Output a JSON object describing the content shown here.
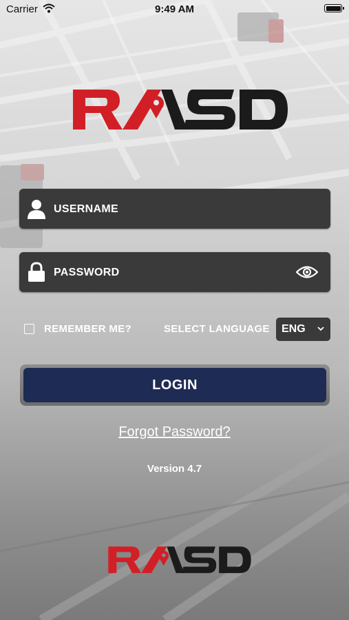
{
  "status_bar": {
    "carrier": "Carrier",
    "time": "9:49 AM"
  },
  "brand": {
    "name": "RASD",
    "red": "#d21f26",
    "dark": "#1b1b1b"
  },
  "form": {
    "username_placeholder": "USERNAME",
    "password_placeholder": "PASSWORD",
    "remember_label": "REMEMBER ME?",
    "remember_checked": false,
    "language_label": "SELECT LANGUAGE",
    "language_value": "ENG",
    "login_label": "LOGIN",
    "forgot_label": "Forgot Password?"
  },
  "footer": {
    "version": "Version 4.7"
  },
  "colors": {
    "field_bg": "#3a3a3a",
    "login_bg": "#1e2b54",
    "text": "#ffffff"
  }
}
